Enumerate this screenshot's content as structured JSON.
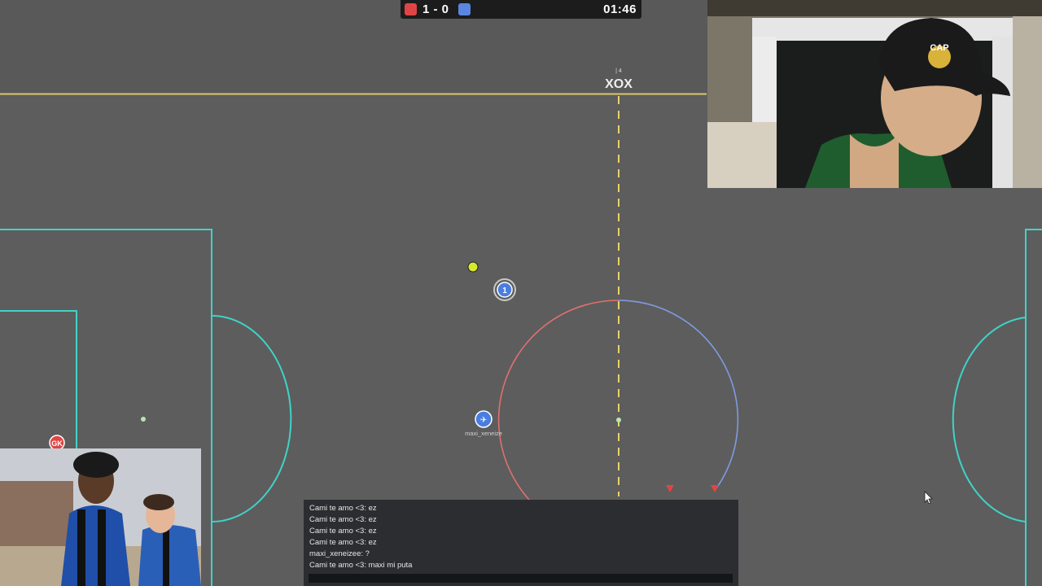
{
  "scoreboard": {
    "red_score": "1",
    "separator": "-",
    "blue_score": "0",
    "score_text": "1 - 0",
    "clock": "01:46",
    "red_color": "#e04545",
    "blue_color": "#5a86e0"
  },
  "field": {
    "background_color": "#5d5d5d",
    "line_color": "#3fd3c8",
    "top_border_color": "#d8c86a",
    "midline_color": "#e8d36a",
    "kickoff_red_color": "#e07070",
    "kickoff_blue_color": "#7f9be0"
  },
  "players": {
    "player_one_number": "1",
    "player_two_name": "maxi_xeneize",
    "player_two_avatar": "✈",
    "goalkeeper_label": "GK",
    "top_marker_text": "| 4",
    "top_marker_logo": "XOX",
    "ball_color": "#d8e82a"
  },
  "chat": {
    "messages": [
      "Cami te amo <3: ez",
      "Cami te amo <3: ez",
      "Cami te amo <3: ez",
      "Cami te amo <3: ez",
      "maxi_xeneizee: ?",
      "Cami te amo <3: maxi mi puta"
    ],
    "input_value": ""
  },
  "webcam": {
    "cap_text": "CAP"
  },
  "icons": {
    "cursor": "mouse-cursor-icon",
    "avatar": "plane-icon"
  }
}
